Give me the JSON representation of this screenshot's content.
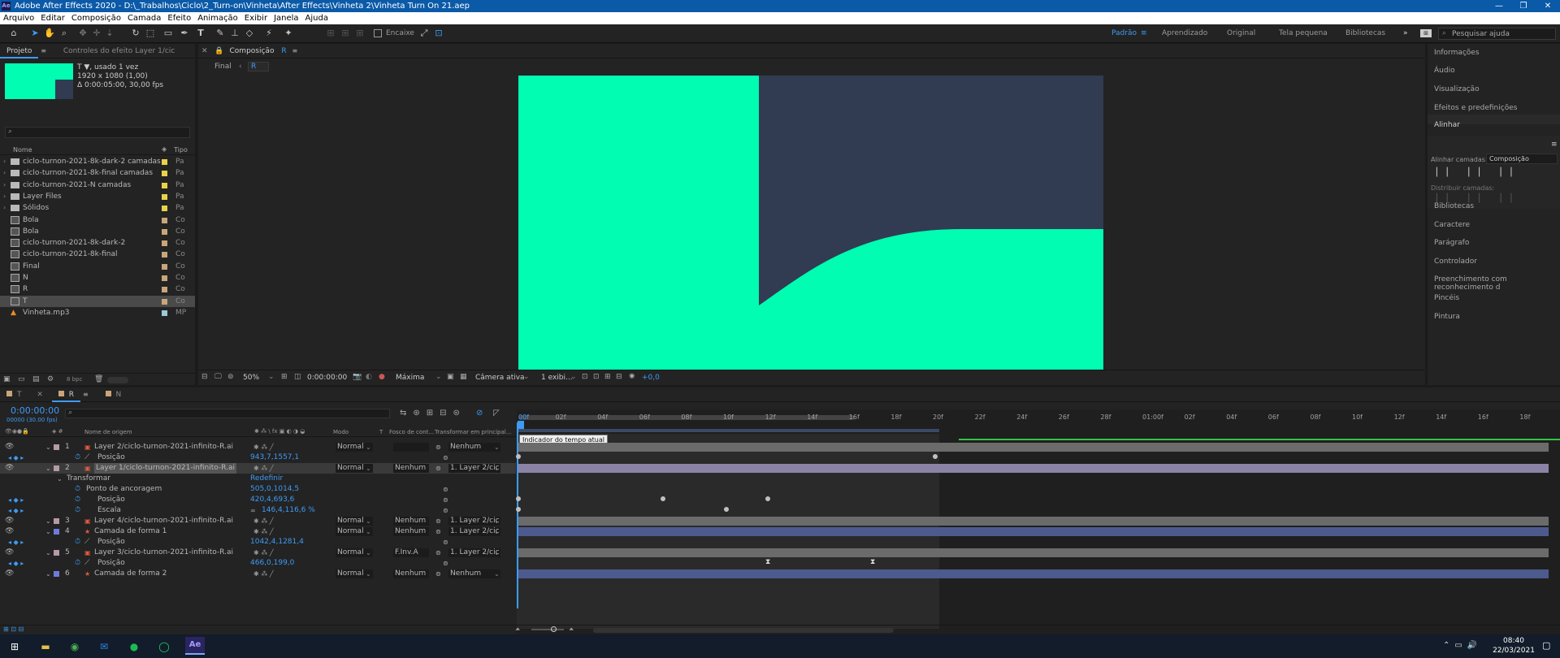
{
  "window": {
    "title": "Adobe After Effects 2020 - D:\\_Trabalhos\\Ciclo\\2_Turn-on\\Vinheta\\After Effects\\Vinheta 2\\Vinheta Turn On 21.aep",
    "app_icon": "Ae"
  },
  "menu": [
    "Arquivo",
    "Editar",
    "Composição",
    "Camada",
    "Efeito",
    "Animação",
    "Exibir",
    "Janela",
    "Ajuda"
  ],
  "toolbar": {
    "snap_label": "Encaixe",
    "workspaces": [
      "Padrão",
      "Aprendizado",
      "Original",
      "Tela pequena",
      "Bibliotecas"
    ],
    "active_workspace": "Padrão",
    "search_placeholder": "Pesquisar ajuda"
  },
  "project": {
    "tabs": [
      "Projeto",
      "Controles do efeito  Layer 1/cic"
    ],
    "info": [
      "T ▼, usado 1 vez",
      "1920 x 1080 (1,00)",
      "Δ 0:00:05:00, 30,00 fps"
    ],
    "col_name": "Nome",
    "col_type": "Tipo",
    "items": [
      {
        "name": "ciclo-turnon-2021-8k-dark-2 camadas",
        "type": "Pa",
        "color": "#e8d24a",
        "kind": "folder"
      },
      {
        "name": "ciclo-turnon-2021-8k-final camadas",
        "type": "Pa",
        "color": "#e8d24a",
        "kind": "folder"
      },
      {
        "name": "ciclo-turnon-2021-N camadas",
        "type": "Pa",
        "color": "#e8d24a",
        "kind": "folder"
      },
      {
        "name": "Layer Files",
        "type": "Pa",
        "color": "#e8d24a",
        "kind": "folder"
      },
      {
        "name": "Sólidos",
        "type": "Pa",
        "color": "#e8d24a",
        "kind": "folder"
      },
      {
        "name": "Bola",
        "type": "Co",
        "color": "#c9a57a",
        "kind": "comp"
      },
      {
        "name": "Bola",
        "type": "Co",
        "color": "#c9a57a",
        "kind": "comp"
      },
      {
        "name": "ciclo-turnon-2021-8k-dark-2",
        "type": "Co",
        "color": "#c9a57a",
        "kind": "comp"
      },
      {
        "name": "ciclo-turnon-2021-8k-final",
        "type": "Co",
        "color": "#c9a57a",
        "kind": "comp"
      },
      {
        "name": "Final",
        "type": "Co",
        "color": "#c9a57a",
        "kind": "comp"
      },
      {
        "name": "N",
        "type": "Co",
        "color": "#c9a57a",
        "kind": "comp"
      },
      {
        "name": "R",
        "type": "Co",
        "color": "#c9a57a",
        "kind": "comp"
      },
      {
        "name": "T",
        "type": "Co",
        "color": "#c9a57a",
        "kind": "comp",
        "selected": true
      },
      {
        "name": "Vinheta.mp3",
        "type": "MP",
        "color": "#9cc8d8",
        "kind": "audio"
      }
    ],
    "bpc": "8 bpc"
  },
  "comp": {
    "tab_label": "Composição",
    "tab_name": "R",
    "breadcrumb": [
      "Final",
      "R"
    ],
    "zoom": "50%",
    "timecode": "0:00:00:00",
    "resolution": "Máxima",
    "camera": "Câmera ativa",
    "views": "1 exibi...",
    "exposure": "+0,0",
    "colors": {
      "green": "#00fdb2",
      "navy": "#313c52"
    }
  },
  "right_panel": [
    "Informações",
    "Áudio",
    "Visualização",
    "Efeitos e predefinições",
    "Alinhar",
    "Bibliotecas",
    "Caractere",
    "Parágrafo",
    "Controlador",
    "Preenchimento com reconhecimento d",
    "Pincéis",
    "Pintura"
  ],
  "align": {
    "label": "Alinhar camadas:",
    "target": "Composição",
    "distribute": "Distribuir camadas:"
  },
  "timeline": {
    "tabs": [
      "T",
      "R",
      "N"
    ],
    "timecode": "0:00:00:00",
    "sub_timecode": "00000 (30.00 fps)",
    "headers": {
      "source": "Nome de origem",
      "mode": "Modo",
      "t": "T",
      "track": "Fosco de cont...",
      "parent": "Transformar em principal..."
    },
    "ticks": [
      "00f",
      "02f",
      "04f",
      "06f",
      "08f",
      "10f",
      "12f",
      "14f",
      "16f",
      "18f",
      "20f",
      "22f",
      "24f",
      "26f",
      "28f",
      "01:00f",
      "02f",
      "04f",
      "06f",
      "08f",
      "10f",
      "12f",
      "14f",
      "16f",
      "18f"
    ],
    "tooltip": "Indicador do tempo atual",
    "layers": [
      {
        "num": "1",
        "name": "Layer 2/ciclo-turnon-2021-infinito-R.ai",
        "mode": "Normal",
        "track": "",
        "parent": "Nenhum",
        "color": "#b59aa8",
        "prop": "Posição",
        "prop_value": "943,7,1557,1"
      },
      {
        "num": "2",
        "name": "Layer 1/ciclo-turnon-2021-infinito-R.ai",
        "mode": "Normal",
        "track": "Nenhum",
        "parent": "1. Layer 2/cic",
        "color": "#b59aa8"
      },
      {
        "num": "3",
        "name": "Layer 4/ciclo-turnon-2021-infinito-R.ai",
        "mode": "Normal",
        "track": "Nenhum",
        "parent": "1. Layer 2/cic",
        "color": "#b59aa8"
      },
      {
        "num": "4",
        "name": "Camada de forma 1",
        "mode": "Normal",
        "track": "Nenhum",
        "parent": "1. Layer 2/cic",
        "color": "#6f7bd8",
        "prop": "Posição",
        "prop_value": "1042,4,1281,4"
      },
      {
        "num": "5",
        "name": "Layer 3/ciclo-turnon-2021-infinito-R.ai",
        "mode": "Normal",
        "track": "F.Inv.A",
        "parent": "1. Layer 2/cic",
        "color": "#b59aa8",
        "prop": "Posição",
        "prop_value": "466,0,199,0"
      },
      {
        "num": "6",
        "name": "Camada de forma 2",
        "mode": "Normal",
        "track": "Nenhum",
        "parent": "Nenhum",
        "color": "#6f7bd8"
      }
    ],
    "transform": {
      "label": "Transformar",
      "reset": "Redefinir",
      "anchor": "Ponto de ancoragem",
      "anchor_value": "505,0,1014,5",
      "position": "Posição",
      "position_value": "420,4,693,6",
      "scale": "Escala",
      "scale_value": "146,4,116,6 %"
    }
  },
  "taskbar": {
    "time": "08:40",
    "date": "22/03/2021"
  }
}
